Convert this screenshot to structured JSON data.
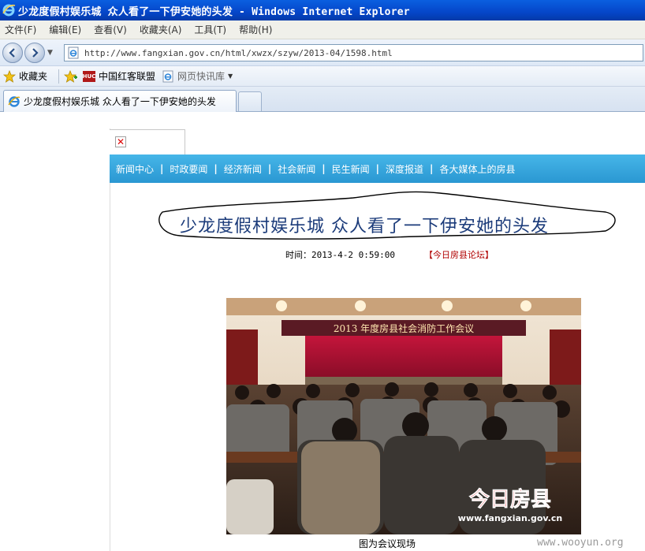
{
  "window": {
    "title": "少龙度假村娱乐城 众人看了一下伊安她的头发 - Windows Internet Explorer"
  },
  "menu": [
    "文件(F)",
    "编辑(E)",
    "查看(V)",
    "收藏夹(A)",
    "工具(T)",
    "帮助(H)"
  ],
  "address_bar": {
    "url": "http://www.fangxian.gov.cn/html/xwzx/szyw/2013-04/1598.html"
  },
  "favorites_bar": {
    "favorites_label": "收藏夹",
    "links": [
      "中国红客联盟",
      "网页快讯库"
    ],
    "huc_logo_text": "HUC"
  },
  "tab": {
    "title": "少龙度假村娱乐城 众人看了一下伊安她的头发"
  },
  "page": {
    "nav": [
      "新闻中心",
      "时政要闻",
      "经济新闻",
      "社会新闻",
      "民生新闻",
      "深度报道",
      "各大媒体上的房县"
    ],
    "nav_separator": "|",
    "headline": "少龙度假村娱乐城 众人看了一下伊安她的头发",
    "date_line": "时间：2013-4-2 0:59:00",
    "forum_link": "【今日房县论坛】",
    "photo": {
      "banner_text": "2013 年度房县社会消防工作会议",
      "logo_text": "今日房县",
      "logo_url": "www.fangxian.gov.cn"
    },
    "caption": "图为会议现场",
    "watermark": "www.wooyun.org"
  },
  "colors": {
    "titlebar": "#0546c9",
    "nav_bar": "#2a97d2",
    "headline": "#1b3b7a",
    "forum_link": "#b00000"
  }
}
